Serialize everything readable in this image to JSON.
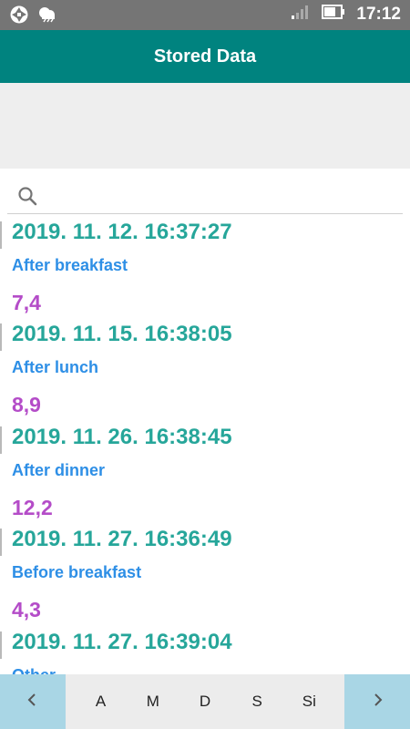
{
  "status_bar": {
    "time": "17:12",
    "left_icons": [
      "aperture-icon",
      "weather-cloud-icon"
    ],
    "right_icons": [
      "signal-icon",
      "battery-icon"
    ]
  },
  "app_bar": {
    "title": "Stored Data"
  },
  "search": {
    "placeholder": ""
  },
  "entries": [
    {
      "datetime": "2019. 11. 12. 16:37:27",
      "note": "After breakfast",
      "value": "7,4"
    },
    {
      "datetime": "2019. 11. 15. 16:38:05",
      "note": "After lunch",
      "value": "8,9"
    },
    {
      "datetime": "2019. 11. 26. 16:38:45",
      "note": "After dinner",
      "value": "12,2"
    },
    {
      "datetime": "2019. 11. 27. 16:36:49",
      "note": "Before breakfast",
      "value": "4,3"
    },
    {
      "datetime": "2019. 11. 27. 16:39:04",
      "note": "Other",
      "value": ""
    }
  ],
  "bottom_bar": {
    "prev_icon": "chevron-left-icon",
    "next_icon": "chevron-right-icon",
    "tabs": [
      "A",
      "M",
      "D",
      "S",
      "Si"
    ]
  },
  "colors": {
    "app_bar": "#00837f",
    "datetime": "#26a69a",
    "note": "#2e8fe6",
    "value": "#b44cc8",
    "nav_button": "#a9d6e5"
  }
}
